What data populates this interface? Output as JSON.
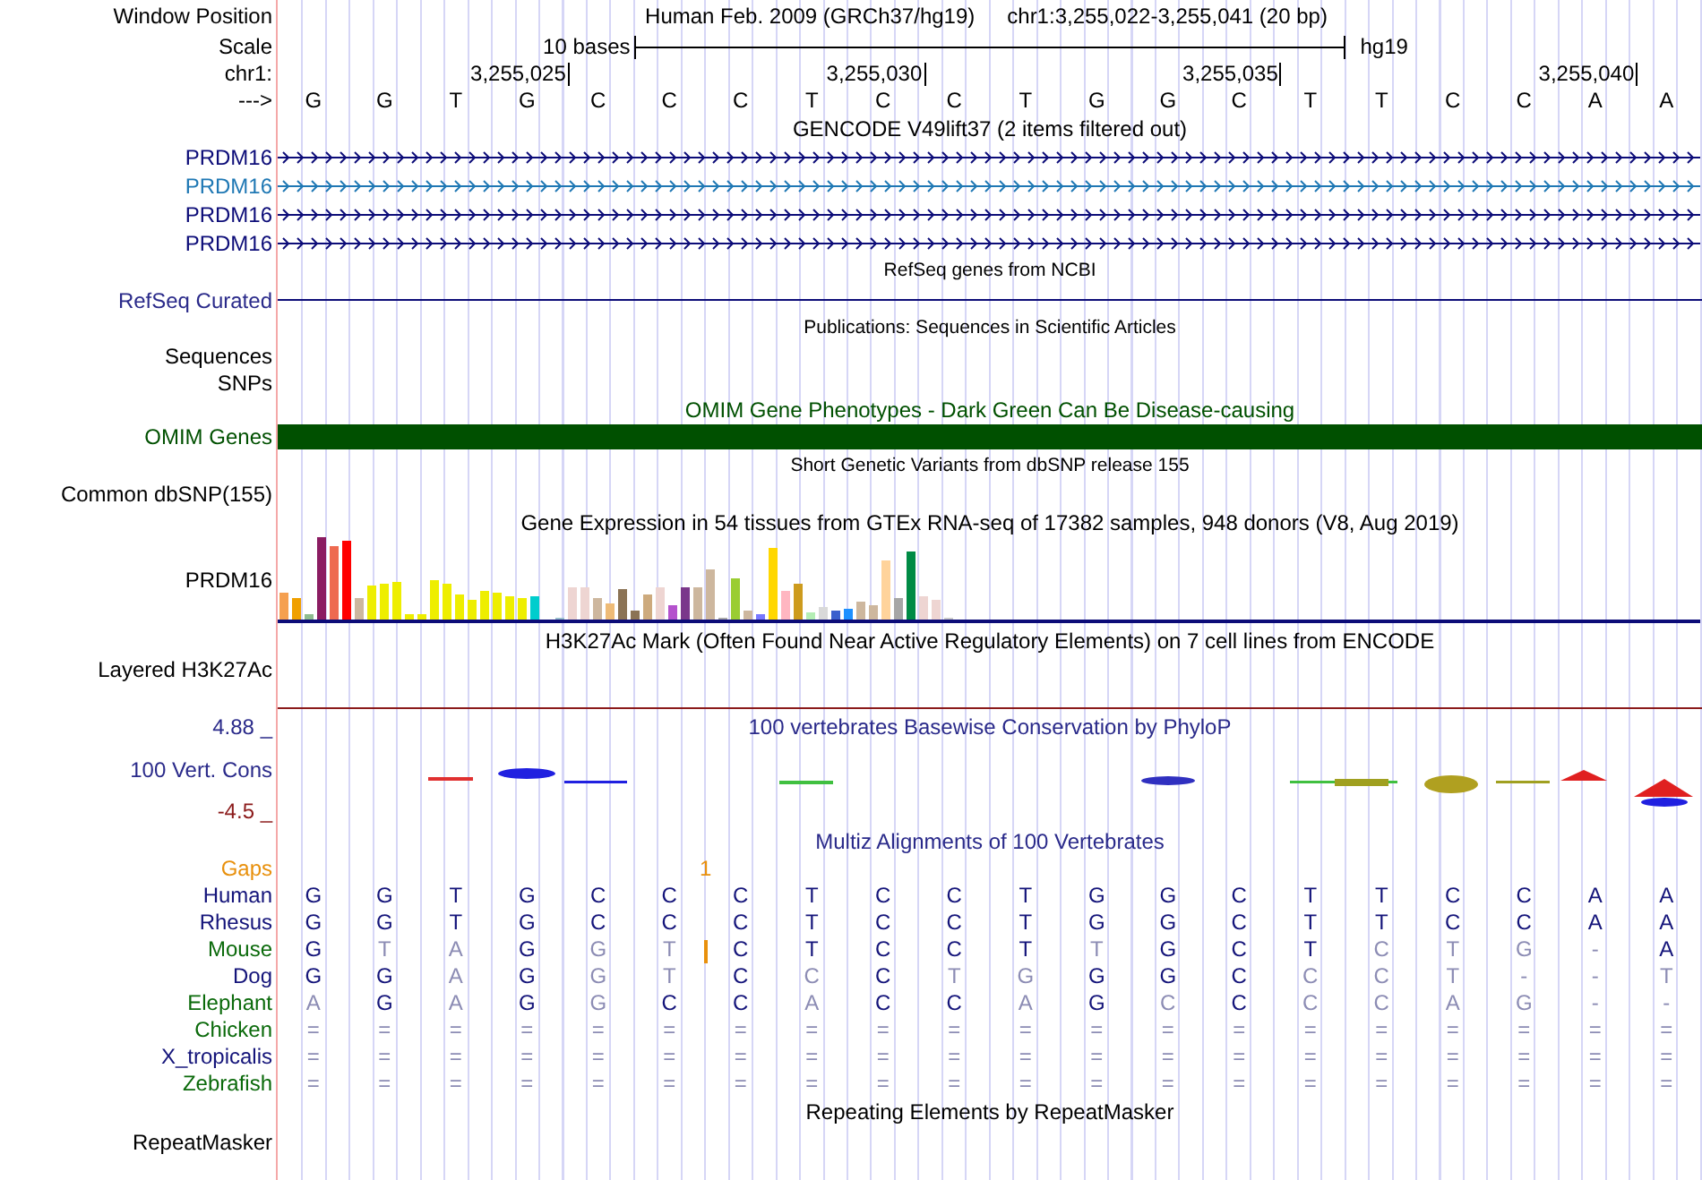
{
  "header": {
    "label": "Window Position",
    "assembly": "Human Feb. 2009 (GRCh37/hg19)",
    "position": "chr1:3,255,022-3,255,041 (20 bp)"
  },
  "scale": {
    "label": "Scale",
    "length": "10 bases",
    "db": "hg19"
  },
  "ruler": {
    "label": "chr1:",
    "ticks": [
      "3,255,025",
      "3,255,030",
      "3,255,035",
      "3,255,040"
    ]
  },
  "sequence": {
    "label": "--->",
    "bases": [
      "G",
      "G",
      "T",
      "G",
      "C",
      "C",
      "C",
      "T",
      "C",
      "C",
      "T",
      "G",
      "G",
      "C",
      "T",
      "T",
      "C",
      "C",
      "A",
      "A"
    ]
  },
  "tracks": [
    {
      "kind": "genes",
      "title": "GENCODE V49lift37 (2 items filtered out)",
      "items": [
        {
          "name": "PRDM16",
          "color": "#0c0c78"
        },
        {
          "name": "PRDM16",
          "color": "#1f78b4"
        },
        {
          "name": "PRDM16",
          "color": "#0c0c78"
        },
        {
          "name": "PRDM16",
          "color": "#0c0c78"
        }
      ]
    },
    {
      "kind": "line",
      "title": "RefSeq genes from NCBI",
      "label": "RefSeq Curated"
    },
    {
      "kind": "labels",
      "title": "Publications: Sequences in Scientific Articles",
      "labels": [
        "Sequences",
        "SNPs"
      ]
    },
    {
      "kind": "bar",
      "title": "OMIM Gene Phenotypes - Dark Green Can Be Disease-causing",
      "label": "OMIM Genes"
    },
    {
      "kind": "empty",
      "title": "Short Genetic Variants from dbSNP release 155",
      "label": "Common dbSNP(155)"
    },
    {
      "kind": "expression",
      "title": "Gene Expression in 54 tissues from GTEx RNA-seq of 17382 samples, 948 donors (V8, Aug 2019)",
      "label": "PRDM16"
    },
    {
      "kind": "layered",
      "title": "H3K27Ac Mark (Often Found Near Active Regulatory Elements) on 7 cell lines from ENCODE",
      "label": "Layered H3K27Ac"
    },
    {
      "kind": "wiggle",
      "title": "100 vertebrates Basewise Conservation by PhyloP",
      "label": "100 Vert. Cons",
      "max": "4.88 _",
      "min": "-4.5 _"
    },
    {
      "kind": "alignment",
      "title": "Multiz Alignments of 100 Vertebrates",
      "gaps": {
        "label": "Gaps",
        "count": "1"
      },
      "species": [
        {
          "name": "Human",
          "color": "#14147a",
          "cells": [
            {
              "base": "G",
              "match": true
            },
            {
              "base": "G",
              "match": true
            },
            {
              "base": "T",
              "match": true
            },
            {
              "base": "G",
              "match": true
            },
            {
              "base": "C",
              "match": true
            },
            {
              "base": "C",
              "match": true
            },
            {
              "base": "C",
              "match": true
            },
            {
              "base": "T",
              "match": true
            },
            {
              "base": "C",
              "match": true
            },
            {
              "base": "C",
              "match": true
            },
            {
              "base": "T",
              "match": true
            },
            {
              "base": "G",
              "match": true
            },
            {
              "base": "G",
              "match": true
            },
            {
              "base": "C",
              "match": true
            },
            {
              "base": "T",
              "match": true
            },
            {
              "base": "T",
              "match": true
            },
            {
              "base": "C",
              "match": true
            },
            {
              "base": "C",
              "match": true
            },
            {
              "base": "A",
              "match": true
            },
            {
              "base": "A",
              "match": true
            }
          ]
        },
        {
          "name": "Rhesus",
          "color": "#14147a",
          "cells": [
            {
              "base": "G",
              "match": true
            },
            {
              "base": "G",
              "match": true
            },
            {
              "base": "T",
              "match": true
            },
            {
              "base": "G",
              "match": true
            },
            {
              "base": "C",
              "match": true
            },
            {
              "base": "C",
              "match": true
            },
            {
              "base": "C",
              "match": true
            },
            {
              "base": "T",
              "match": true
            },
            {
              "base": "C",
              "match": true
            },
            {
              "base": "C",
              "match": true
            },
            {
              "base": "T",
              "match": true
            },
            {
              "base": "G",
              "match": true
            },
            {
              "base": "G",
              "match": true
            },
            {
              "base": "C",
              "match": true
            },
            {
              "base": "T",
              "match": true
            },
            {
              "base": "T",
              "match": true
            },
            {
              "base": "C",
              "match": true
            },
            {
              "base": "C",
              "match": true
            },
            {
              "base": "A",
              "match": true
            },
            {
              "base": "A",
              "match": true
            }
          ]
        },
        {
          "name": "Mouse",
          "color": "#0b6a0b",
          "cells": [
            {
              "base": "G",
              "match": true
            },
            {
              "base": "T",
              "match": false
            },
            {
              "base": "A",
              "match": false
            },
            {
              "base": "G",
              "match": true
            },
            {
              "base": "G",
              "match": false
            },
            {
              "base": "T",
              "match": false
            },
            {
              "base": "C",
              "match": true,
              "insertion": true
            },
            {
              "base": "T",
              "match": true
            },
            {
              "base": "C",
              "match": true
            },
            {
              "base": "C",
              "match": true
            },
            {
              "base": "T",
              "match": true
            },
            {
              "base": "T",
              "match": false
            },
            {
              "base": "G",
              "match": true
            },
            {
              "base": "C",
              "match": true
            },
            {
              "base": "T",
              "match": true
            },
            {
              "base": "C",
              "match": false
            },
            {
              "base": "T",
              "match": false
            },
            {
              "base": "G",
              "match": false
            },
            {
              "base": "-",
              "match": false
            },
            {
              "base": "A",
              "match": true
            }
          ]
        },
        {
          "name": "Dog",
          "color": "#14147a",
          "cells": [
            {
              "base": "G",
              "match": true
            },
            {
              "base": "G",
              "match": true
            },
            {
              "base": "A",
              "match": false
            },
            {
              "base": "G",
              "match": true
            },
            {
              "base": "G",
              "match": false
            },
            {
              "base": "T",
              "match": false
            },
            {
              "base": "C",
              "match": true
            },
            {
              "base": "C",
              "match": false
            },
            {
              "base": "C",
              "match": true
            },
            {
              "base": "T",
              "match": false
            },
            {
              "base": "G",
              "match": false
            },
            {
              "base": "G",
              "match": true
            },
            {
              "base": "G",
              "match": true
            },
            {
              "base": "C",
              "match": true
            },
            {
              "base": "C",
              "match": false
            },
            {
              "base": "C",
              "match": false
            },
            {
              "base": "T",
              "match": false
            },
            {
              "base": "-",
              "match": false
            },
            {
              "base": "-",
              "match": false
            },
            {
              "base": "T",
              "match": false
            }
          ]
        },
        {
          "name": "Elephant",
          "color": "#0b6a0b",
          "cells": [
            {
              "base": "A",
              "match": false
            },
            {
              "base": "G",
              "match": true
            },
            {
              "base": "A",
              "match": false
            },
            {
              "base": "G",
              "match": true
            },
            {
              "base": "G",
              "match": false
            },
            {
              "base": "C",
              "match": true
            },
            {
              "base": "C",
              "match": true
            },
            {
              "base": "A",
              "match": false
            },
            {
              "base": "C",
              "match": true
            },
            {
              "base": "C",
              "match": true
            },
            {
              "base": "A",
              "match": false
            },
            {
              "base": "G",
              "match": true
            },
            {
              "base": "C",
              "match": false
            },
            {
              "base": "C",
              "match": true
            },
            {
              "base": "C",
              "match": false
            },
            {
              "base": "C",
              "match": false
            },
            {
              "base": "A",
              "match": false
            },
            {
              "base": "G",
              "match": false
            },
            {
              "base": "-",
              "match": false
            },
            {
              "base": "-",
              "match": false
            }
          ]
        },
        {
          "name": "Chicken",
          "color": "#0b6a0b",
          "cells": [
            {
              "base": "=",
              "match": false
            },
            {
              "base": "=",
              "match": false
            },
            {
              "base": "=",
              "match": false
            },
            {
              "base": "=",
              "match": false
            },
            {
              "base": "=",
              "match": false
            },
            {
              "base": "=",
              "match": false
            },
            {
              "base": "=",
              "match": false
            },
            {
              "base": "=",
              "match": false
            },
            {
              "base": "=",
              "match": false
            },
            {
              "base": "=",
              "match": false
            },
            {
              "base": "=",
              "match": false
            },
            {
              "base": "=",
              "match": false
            },
            {
              "base": "=",
              "match": false
            },
            {
              "base": "=",
              "match": false
            },
            {
              "base": "=",
              "match": false
            },
            {
              "base": "=",
              "match": false
            },
            {
              "base": "=",
              "match": false
            },
            {
              "base": "=",
              "match": false
            },
            {
              "base": "=",
              "match": false
            },
            {
              "base": "=",
              "match": false
            }
          ]
        },
        {
          "name": "X_tropicalis",
          "color": "#14147a",
          "cells": [
            {
              "base": "=",
              "match": false
            },
            {
              "base": "=",
              "match": false
            },
            {
              "base": "=",
              "match": false
            },
            {
              "base": "=",
              "match": false
            },
            {
              "base": "=",
              "match": false
            },
            {
              "base": "=",
              "match": false
            },
            {
              "base": "=",
              "match": false
            },
            {
              "base": "=",
              "match": false
            },
            {
              "base": "=",
              "match": false
            },
            {
              "base": "=",
              "match": false
            },
            {
              "base": "=",
              "match": false
            },
            {
              "base": "=",
              "match": false
            },
            {
              "base": "=",
              "match": false
            },
            {
              "base": "=",
              "match": false
            },
            {
              "base": "=",
              "match": false
            },
            {
              "base": "=",
              "match": false
            },
            {
              "base": "=",
              "match": false
            },
            {
              "base": "=",
              "match": false
            },
            {
              "base": "=",
              "match": false
            },
            {
              "base": "=",
              "match": false
            }
          ]
        },
        {
          "name": "Zebrafish",
          "color": "#0b6a0b",
          "cells": [
            {
              "base": "=",
              "match": false
            },
            {
              "base": "=",
              "match": false
            },
            {
              "base": "=",
              "match": false
            },
            {
              "base": "=",
              "match": false
            },
            {
              "base": "=",
              "match": false
            },
            {
              "base": "=",
              "match": false
            },
            {
              "base": "=",
              "match": false
            },
            {
              "base": "=",
              "match": false
            },
            {
              "base": "=",
              "match": false
            },
            {
              "base": "=",
              "match": false
            },
            {
              "base": "=",
              "match": false
            },
            {
              "base": "=",
              "match": false
            },
            {
              "base": "=",
              "match": false
            },
            {
              "base": "=",
              "match": false
            },
            {
              "base": "=",
              "match": false
            },
            {
              "base": "=",
              "match": false
            },
            {
              "base": "=",
              "match": false
            },
            {
              "base": "=",
              "match": false
            },
            {
              "base": "=",
              "match": false
            },
            {
              "base": "=",
              "match": false
            }
          ]
        }
      ]
    },
    {
      "kind": "annotation",
      "title": "Repeating Elements by RepeatMasker",
      "label": "RepeatMasker"
    }
  ]
}
